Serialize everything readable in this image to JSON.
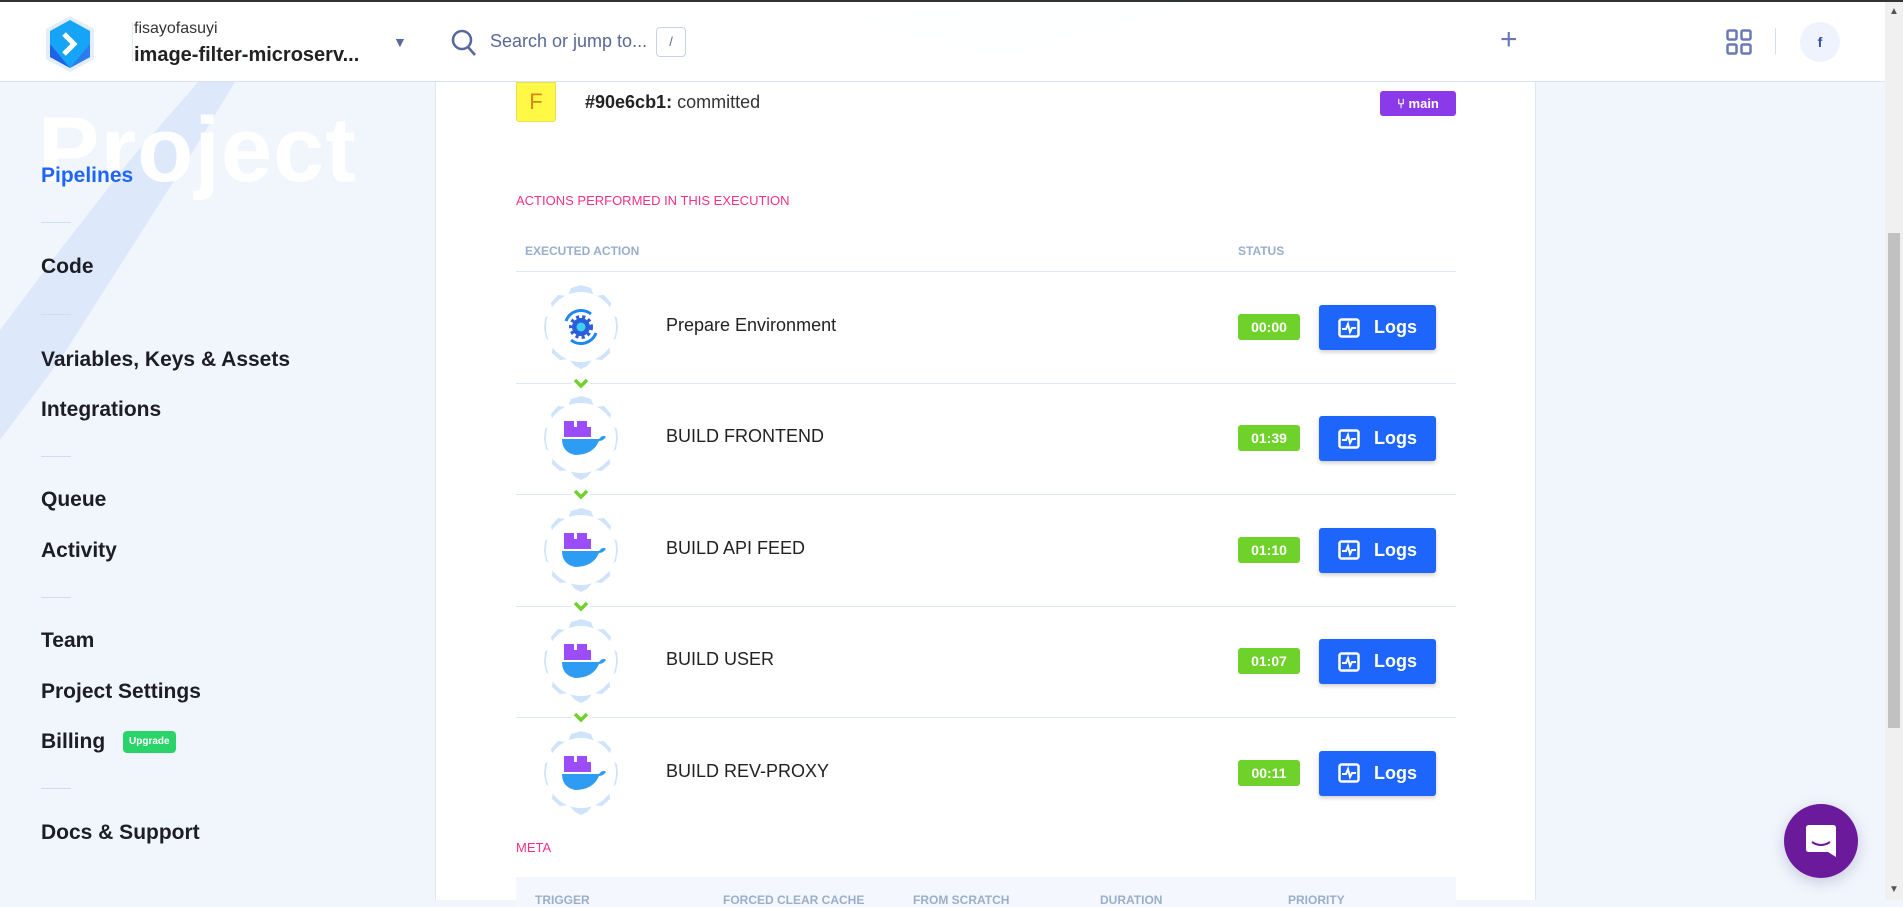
{
  "header": {
    "org": "fisayofasuyi",
    "project": "image-filter-microserv...",
    "search_placeholder": "Search or jump to...",
    "search_shortcut": "/",
    "avatar_letter": "f"
  },
  "sidebar": {
    "watermark": "Project",
    "items": [
      {
        "label": "Pipelines",
        "active": true
      },
      {
        "label": "Code"
      },
      {
        "label": "Variables, Keys & Assets"
      },
      {
        "label": "Integrations"
      },
      {
        "label": "Queue"
      },
      {
        "label": "Activity"
      },
      {
        "label": "Team"
      },
      {
        "label": "Project Settings"
      },
      {
        "label": "Billing",
        "badge": "Upgrade"
      },
      {
        "label": "Docs & Support"
      }
    ]
  },
  "commit": {
    "avatar_letter": "F",
    "hash": "#90e6cb1:",
    "message": "committed",
    "branch": "main"
  },
  "actions": {
    "section_title": "ACTIONS PERFORMED IN THIS EXECUTION",
    "col_action": "EXECUTED ACTION",
    "col_status": "STATUS",
    "logs_label": "Logs",
    "rows": [
      {
        "name": "Prepare Environment",
        "duration": "00:00",
        "icon": "prepare-env"
      },
      {
        "name": "BUILD FRONTEND",
        "duration": "01:39",
        "icon": "docker"
      },
      {
        "name": "BUILD API FEED",
        "duration": "01:10",
        "icon": "docker"
      },
      {
        "name": "BUILD USER",
        "duration": "01:07",
        "icon": "docker"
      },
      {
        "name": "BUILD REV-PROXY",
        "duration": "00:11",
        "icon": "docker"
      }
    ]
  },
  "meta": {
    "section_title": "META",
    "columns": [
      "TRIGGER",
      "FORCED CLEAR CACHE",
      "FROM SCRATCH",
      "DURATION",
      "PRIORITY"
    ]
  },
  "colors": {
    "accent": "#1e66fb",
    "success": "#6fd22a",
    "pink": "#f0308a",
    "branch": "#8a3ae8",
    "chat": "#6b1a9c"
  }
}
